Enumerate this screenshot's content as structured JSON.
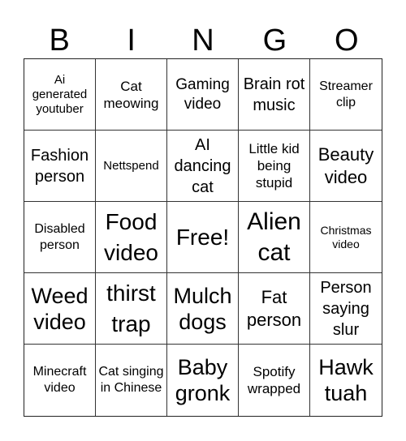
{
  "header": {
    "letters": [
      "B",
      "I",
      "N",
      "G",
      "O"
    ]
  },
  "cells": [
    "Ai generated youtuber",
    "Cat meowing",
    "Gaming video",
    "Brain rot music",
    "Streamer clip",
    "Fashion person",
    "Nettspend",
    "AI dancing cat",
    "Little kid being stupid",
    "Beauty video",
    "Disabled person",
    "Food video",
    "Free!",
    "Alien cat",
    "Christmas video",
    "Weed video",
    "thirst trap",
    "Mulch dogs",
    "Fat person",
    "Person saying slur",
    "Minecraft video",
    "Cat singing in Chinese",
    "Baby gronk",
    "Spotify wrapped",
    "Hawk tuah"
  ]
}
